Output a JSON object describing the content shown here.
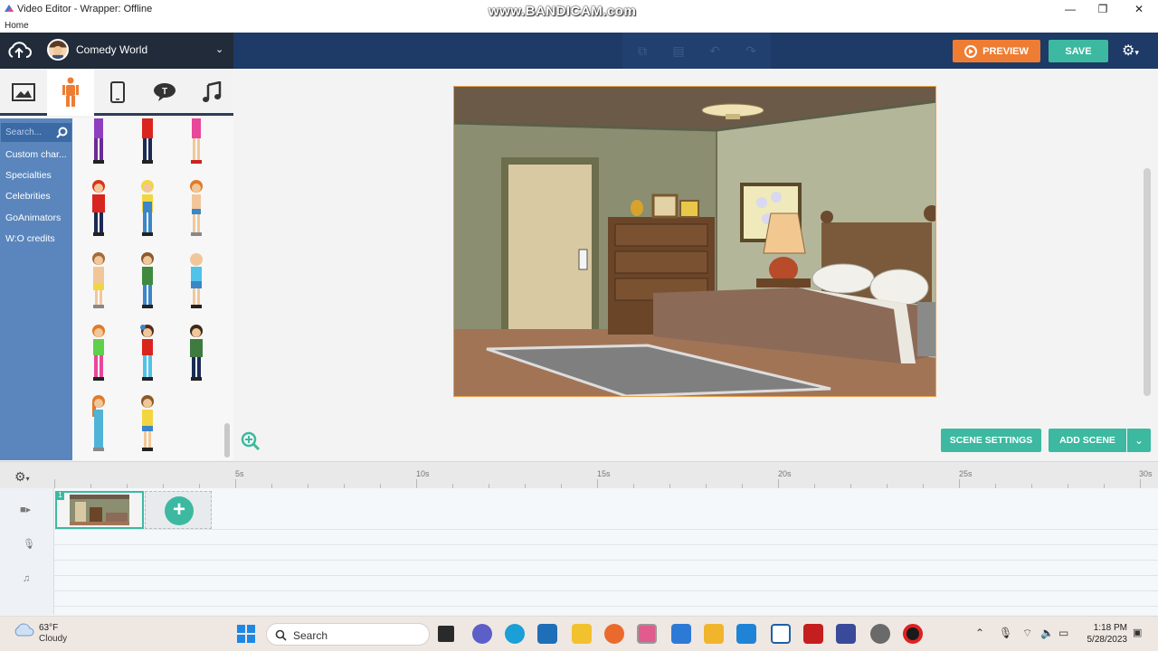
{
  "window": {
    "title": "Video Editor - Wrapper: Offline",
    "watermark": "www.BANDICAM.com",
    "menu_home": "Home",
    "minimize": "—",
    "maximize": "❐",
    "close": "✕"
  },
  "appbar": {
    "theme_name": "Comedy World",
    "preview_label": "PREVIEW",
    "save_label": "SAVE",
    "colors": {
      "bar": "#1e3a66",
      "preview": "#ee7d33",
      "save": "#3cb9a0"
    }
  },
  "left_panel": {
    "tabs": [
      {
        "icon": "image-icon",
        "active": false
      },
      {
        "icon": "person-icon",
        "active": true
      },
      {
        "icon": "phone-icon",
        "active": false
      },
      {
        "icon": "speech-bubble-icon",
        "active": false
      },
      {
        "icon": "music-note-icon",
        "active": false
      }
    ],
    "search_placeholder": "Search...",
    "categories": [
      "Custom char...",
      "Specialties",
      "Celebrities",
      "GoAnimators",
      "W:O credits"
    ]
  },
  "stage": {
    "scene_settings_label": "SCENE SETTINGS",
    "add_scene_label": "ADD SCENE"
  },
  "timeline": {
    "ticks": [
      "5s",
      "10s",
      "15s",
      "20s",
      "25s",
      "30s"
    ],
    "scene_number": "1"
  },
  "taskbar": {
    "temperature": "63°F",
    "condition": "Cloudy",
    "search_label": "Search",
    "time": "1:18 PM",
    "date": "5/28/2023"
  }
}
